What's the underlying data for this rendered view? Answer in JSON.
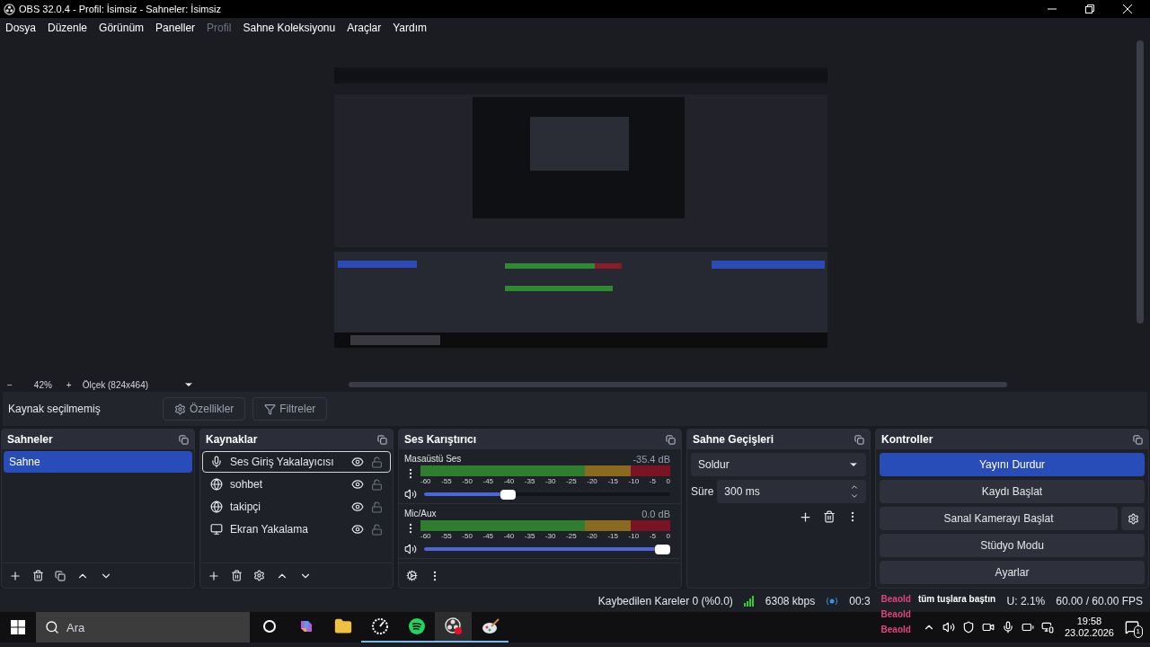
{
  "window": {
    "title": "OBS 32.0.4 - Profil: İsimsiz - Sahneler: İsimsiz"
  },
  "menu": [
    {
      "label": "Dosya",
      "disabled": false
    },
    {
      "label": "Düzenle",
      "disabled": false
    },
    {
      "label": "Görünüm",
      "disabled": false
    },
    {
      "label": "Paneller",
      "disabled": false
    },
    {
      "label": "Profil",
      "disabled": true
    },
    {
      "label": "Sahne Koleksiyonu",
      "disabled": false
    },
    {
      "label": "Araçlar",
      "disabled": false
    },
    {
      "label": "Yardım",
      "disabled": false
    }
  ],
  "zoom_bar": {
    "minus": "−",
    "zoom": "42%",
    "plus": "+",
    "scale": "Ölçek (824x464)"
  },
  "source_toolbar": {
    "status": "Kaynak seçilmemiş",
    "buttons": [
      {
        "label": "Özellikler",
        "kind": "gear"
      },
      {
        "label": "Filtreler",
        "kind": "filter"
      }
    ]
  },
  "scenes": {
    "title": "Sahneler",
    "items": [
      {
        "label": "Sahne",
        "selected": true
      }
    ]
  },
  "sources": {
    "title": "Kaynaklar",
    "items": [
      {
        "label": "Ses Giriş Yakalayıcısı",
        "kind": "audio_input",
        "selected": true,
        "visible": true,
        "locked": false
      },
      {
        "label": "sohbet",
        "kind": "browser",
        "selected": false,
        "visible": true,
        "locked": false
      },
      {
        "label": "takipçi",
        "kind": "browser",
        "selected": false,
        "visible": true,
        "locked": false
      },
      {
        "label": "Ekran Yakalama",
        "kind": "display",
        "selected": false,
        "visible": true,
        "locked": false
      }
    ]
  },
  "mixer": {
    "title": "Ses Karıştırıcı",
    "channels": [
      {
        "name": "Masaüstü Ses",
        "reading": "-35.4 dB",
        "level": 0.33,
        "muted": false,
        "scale": [
          "-60",
          "-55",
          "-50",
          "-45",
          "-40",
          "-35",
          "-30",
          "-25",
          "-20",
          "-15",
          "-10",
          "-5",
          "0"
        ]
      },
      {
        "name": "Mic/Aux",
        "reading": "0.0 dB",
        "level": 1,
        "muted": false,
        "scale": [
          "-60",
          "-55",
          "-50",
          "-45",
          "-40",
          "-35",
          "-30",
          "-25",
          "-20",
          "-15",
          "-10",
          "-5",
          "0"
        ]
      }
    ]
  },
  "transitions": {
    "title": "Sahne Geçişleri",
    "transition": "Soldur",
    "duration_label": "Süre",
    "duration": "300 ms"
  },
  "controls": {
    "title": "Kontroller",
    "buttons": [
      {
        "label": "Yayını Durdur",
        "active": true,
        "settings": false
      },
      {
        "label": "Kaydı Başlat",
        "active": false,
        "settings": false
      },
      {
        "label": "Sanal Kamerayı Başlat",
        "active": false,
        "settings": true
      },
      {
        "label": "Stüdyo Modu",
        "active": false,
        "settings": false
      },
      {
        "label": "Ayarlar",
        "active": false,
        "settings": false
      }
    ]
  },
  "status_bar": {
    "dropped": "Kaybedilen Kareler 0 (%0.0)",
    "bitrate": "6308 kbps",
    "stream_time": "00:3",
    "cpu": "U: 2.1%",
    "fps": "60.00 / 60.00 FPS"
  },
  "chat_overlay": [
    {
      "user": "Beaold",
      "text": "tüm tuşlara baştın"
    },
    {
      "user": "Beaold"
    },
    {
      "user": "Beaold"
    }
  ],
  "taskbar": {
    "search_placeholder": "Ara",
    "apps": [
      {
        "kind": "cortana",
        "running": false,
        "selected": false
      },
      {
        "kind": "copilot",
        "running": false,
        "selected": false
      },
      {
        "kind": "folder",
        "running": false,
        "selected": false
      },
      {
        "kind": "gauge",
        "running": true,
        "selected": false
      },
      {
        "kind": "spotify",
        "running": true,
        "selected": false
      },
      {
        "kind": "obs",
        "running": true,
        "selected": true
      },
      {
        "kind": "paint",
        "running": true,
        "selected": false
      }
    ],
    "time": "19:58",
    "date": "23.02.2026",
    "notifications": "1"
  }
}
